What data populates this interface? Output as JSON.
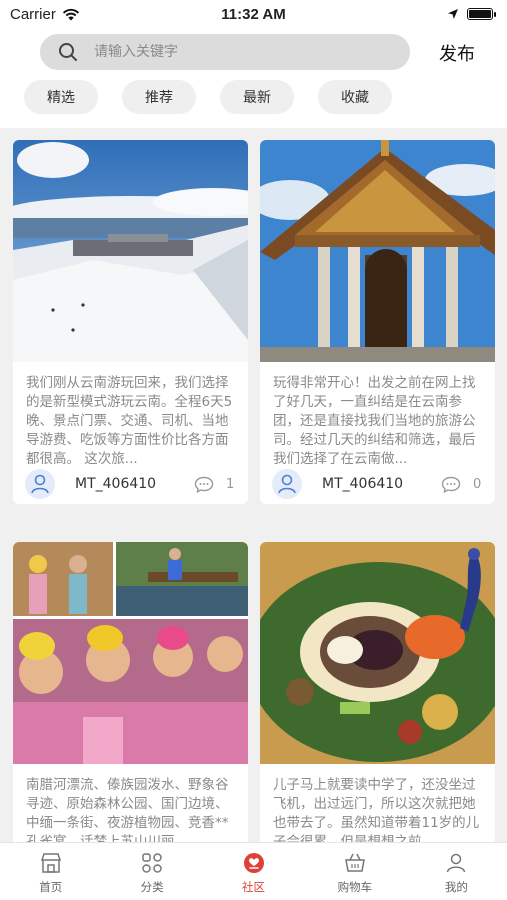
{
  "status_bar": {
    "carrier": "Carrier",
    "time": "11:32 AM"
  },
  "search": {
    "placeholder": "请输入关键字"
  },
  "publish_label": "发布",
  "chips": [
    "精选",
    "推荐",
    "最新",
    "收藏"
  ],
  "posts": [
    {
      "text": "我们刚从云南游玩回来，我们选择的是新型模式游玩云南。全程6天5晚、景点门票、交通、司机、当地导游费、吃饭等方面性价比各方面都很高。 这次旅...",
      "author": "MT_406410",
      "comments": "1"
    },
    {
      "text": "玩得非常开心！出发之前在网上找了好几天，一直纠结是在云南参团，还是直接找我们当地的旅游公司。经过几天的纠结和筛选，最后我们选择了在云南做...",
      "author": "MT_406410",
      "comments": "0"
    },
    {
      "text": "南腊河漂流、傣族园泼水、野象谷寻迹、原始森林公园、国门边境、中缅一条街、夜游植物园、竞香**孔雀宴、话梦上苏山川丽...",
      "author": "",
      "comments": ""
    },
    {
      "text": "儿子马上就要读中学了，还没坐过飞机，出过远门，所以这次就把她也带去了。虽然知道带着11岁的儿子会很累，但是想想之前...",
      "author": "",
      "comments": ""
    }
  ],
  "tabs": [
    {
      "label": "首页",
      "icon": "shop-icon",
      "active": false
    },
    {
      "label": "分类",
      "icon": "grid-icon",
      "active": false
    },
    {
      "label": "社区",
      "icon": "community-icon",
      "active": true
    },
    {
      "label": "购物车",
      "icon": "cart-icon",
      "active": false
    },
    {
      "label": "我的",
      "icon": "person-icon",
      "active": false
    }
  ],
  "colors": {
    "accent": "#e0403a",
    "feed_bg": "#f0f0f0",
    "search_bg": "#dcdcdc"
  }
}
